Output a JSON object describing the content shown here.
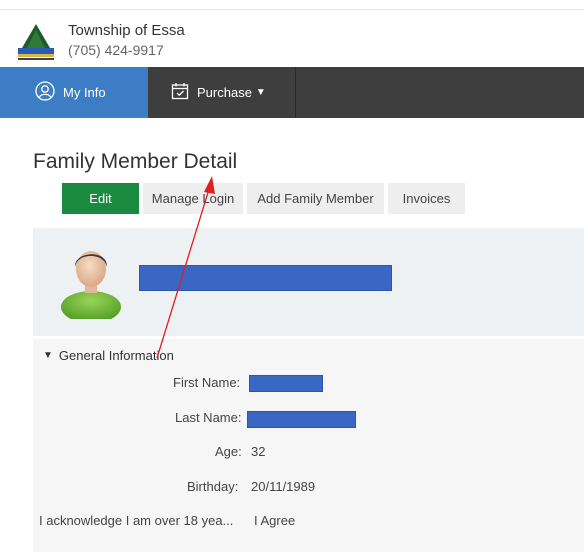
{
  "header": {
    "org_name": "Township of Essa",
    "org_phone": "(705) 424-9917"
  },
  "nav": {
    "my_info": "My Info",
    "purchase": "Purchase",
    "purchase_caret": "▼"
  },
  "page": {
    "title": "Family Member Detail"
  },
  "actions": {
    "edit": "Edit",
    "manage_login": "Manage Login",
    "add_family_member": "Add Family Member",
    "invoices": "Invoices"
  },
  "section": {
    "title": "General Information",
    "chevron": "▼"
  },
  "fields": {
    "first_name_label": "First Name:",
    "last_name_label": "Last Name:",
    "age_label": "Age:",
    "age_value": "32",
    "birthday_label": "Birthday:",
    "birthday_value": "20/11/1989",
    "acknowledge_label": "I acknowledge I am over 18 yea...",
    "acknowledge_value": "I Agree"
  },
  "colors": {
    "nav_active": "#3c7dc5",
    "nav_bg": "#3e3e3e",
    "edit_button": "#1a8a3e",
    "redaction": "#3a66c4",
    "annotation_arrow": "#e02020"
  }
}
